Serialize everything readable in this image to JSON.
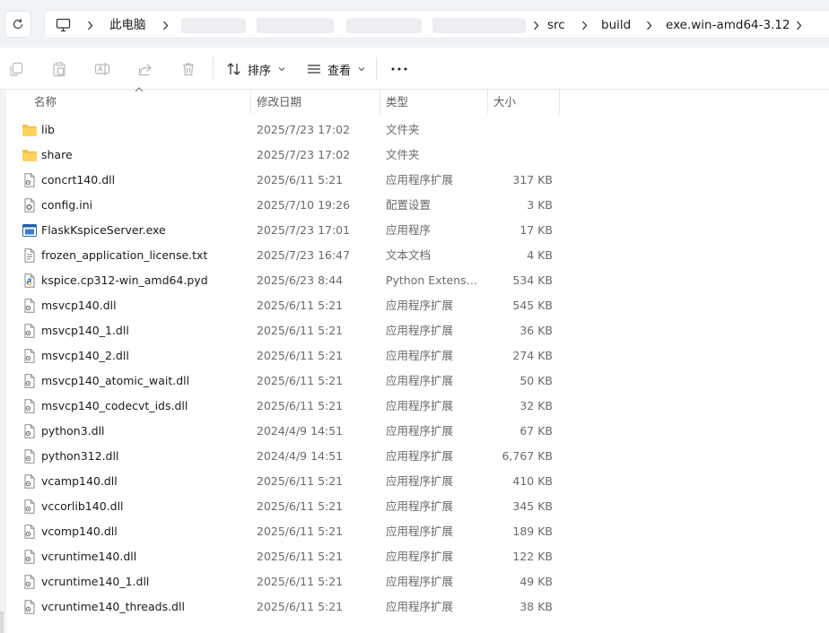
{
  "address": {
    "crumbs": [
      "此电脑",
      "src",
      "build",
      "exe.win-amd64-3.12"
    ]
  },
  "toolbar": {
    "sort_label": "排序",
    "view_label": "查看",
    "more_label": "..."
  },
  "columns": {
    "name": "名称",
    "date": "修改日期",
    "type": "类型",
    "size": "大小"
  },
  "files": [
    {
      "name": "lib",
      "date": "2025/7/23 17:02",
      "type": "文件夹",
      "size": "",
      "icon": "folder-icon"
    },
    {
      "name": "share",
      "date": "2025/7/23 17:02",
      "type": "文件夹",
      "size": "",
      "icon": "folder-icon"
    },
    {
      "name": "concrt140.dll",
      "date": "2025/6/11 5:21",
      "type": "应用程序扩展",
      "size": "317 KB",
      "icon": "dll-file-icon"
    },
    {
      "name": "config.ini",
      "date": "2025/7/10 19:26",
      "type": "配置设置",
      "size": "3 KB",
      "icon": "ini-file-icon"
    },
    {
      "name": "FlaskKspiceServer.exe",
      "date": "2025/7/23 17:01",
      "type": "应用程序",
      "size": "17 KB",
      "icon": "exe-file-icon"
    },
    {
      "name": "frozen_application_license.txt",
      "date": "2025/7/23 16:47",
      "type": "文本文档",
      "size": "4 KB",
      "icon": "text-file-icon"
    },
    {
      "name": "kspice.cp312-win_amd64.pyd",
      "date": "2025/6/23 8:44",
      "type": "Python Extension Module",
      "size": "534 KB",
      "icon": "pyd-file-icon"
    },
    {
      "name": "msvcp140.dll",
      "date": "2025/6/11 5:21",
      "type": "应用程序扩展",
      "size": "545 KB",
      "icon": "dll-file-icon"
    },
    {
      "name": "msvcp140_1.dll",
      "date": "2025/6/11 5:21",
      "type": "应用程序扩展",
      "size": "36 KB",
      "icon": "dll-file-icon"
    },
    {
      "name": "msvcp140_2.dll",
      "date": "2025/6/11 5:21",
      "type": "应用程序扩展",
      "size": "274 KB",
      "icon": "dll-file-icon"
    },
    {
      "name": "msvcp140_atomic_wait.dll",
      "date": "2025/6/11 5:21",
      "type": "应用程序扩展",
      "size": "50 KB",
      "icon": "dll-file-icon"
    },
    {
      "name": "msvcp140_codecvt_ids.dll",
      "date": "2025/6/11 5:21",
      "type": "应用程序扩展",
      "size": "32 KB",
      "icon": "dll-file-icon"
    },
    {
      "name": "python3.dll",
      "date": "2024/4/9 14:51",
      "type": "应用程序扩展",
      "size": "67 KB",
      "icon": "dll-file-icon"
    },
    {
      "name": "python312.dll",
      "date": "2024/4/9 14:51",
      "type": "应用程序扩展",
      "size": "6,767 KB",
      "icon": "dll-file-icon"
    },
    {
      "name": "vcamp140.dll",
      "date": "2025/6/11 5:21",
      "type": "应用程序扩展",
      "size": "410 KB",
      "icon": "dll-file-icon"
    },
    {
      "name": "vccorlib140.dll",
      "date": "2025/6/11 5:21",
      "type": "应用程序扩展",
      "size": "345 KB",
      "icon": "dll-file-icon"
    },
    {
      "name": "vcomp140.dll",
      "date": "2025/6/11 5:21",
      "type": "应用程序扩展",
      "size": "189 KB",
      "icon": "dll-file-icon"
    },
    {
      "name": "vcruntime140.dll",
      "date": "2025/6/11 5:21",
      "type": "应用程序扩展",
      "size": "122 KB",
      "icon": "dll-file-icon"
    },
    {
      "name": "vcruntime140_1.dll",
      "date": "2025/6/11 5:21",
      "type": "应用程序扩展",
      "size": "49 KB",
      "icon": "dll-file-icon"
    },
    {
      "name": "vcruntime140_threads.dll",
      "date": "2025/6/11 5:21",
      "type": "应用程序扩展",
      "size": "38 KB",
      "icon": "dll-file-icon"
    }
  ]
}
